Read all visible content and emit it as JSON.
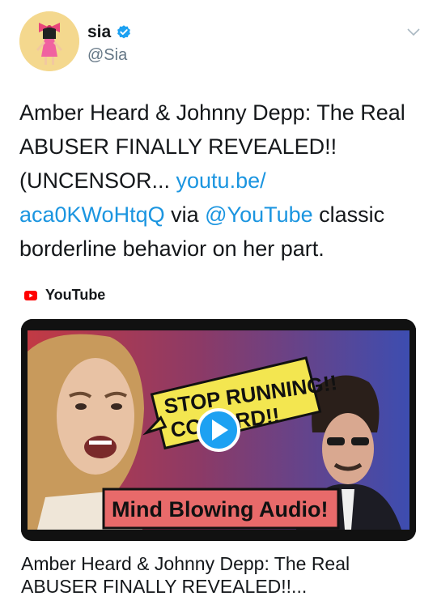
{
  "author": {
    "display_name": "sia",
    "handle": "@Sia"
  },
  "tweet": {
    "text_part1": "Amber Heard & Johnny Depp:  The Real ABUSER FINALLY REVEALED!! (UNCENSOR... ",
    "link1_line1": "youtu.be/",
    "link1_line2": "aca0KWoHtqQ",
    "text_part2": " via ",
    "mention": "@YouTube",
    "text_part3": " classic borderline behavior on her part."
  },
  "card": {
    "source": "YouTube",
    "thumbnail_caption_top": "STOP RUNNING!!",
    "thumbnail_caption_bottom": "COWARD!!",
    "thumbnail_banner": "Mind Blowing Audio!",
    "title": "Amber Heard & Johnny Depp: The Real ABUSER FINALLY REVEALED!!..."
  },
  "colors": {
    "link": "#1b95e0",
    "verified": "#1da1f2",
    "youtube": "#ff0000"
  }
}
